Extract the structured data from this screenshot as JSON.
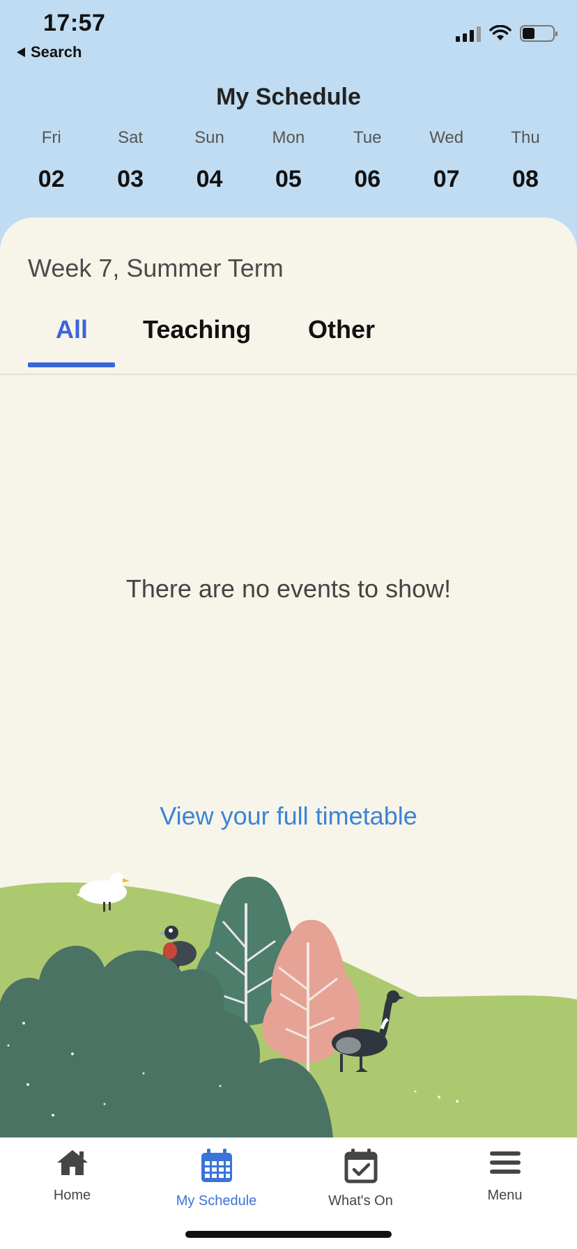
{
  "status_bar": {
    "time": "17:57",
    "back_label": "Search",
    "battery_level": 0.4
  },
  "header": {
    "title": "My Schedule"
  },
  "days": [
    {
      "name": "Fri",
      "num": "02"
    },
    {
      "name": "Sat",
      "num": "03"
    },
    {
      "name": "Sun",
      "num": "04"
    },
    {
      "name": "Mon",
      "num": "05"
    },
    {
      "name": "Tue",
      "num": "06"
    },
    {
      "name": "Wed",
      "num": "07"
    },
    {
      "name": "Thu",
      "num": "08"
    }
  ],
  "main": {
    "week_label": "Week 7, Summer Term",
    "tabs": [
      {
        "label": "All",
        "active": true
      },
      {
        "label": "Teaching",
        "active": false
      },
      {
        "label": "Other",
        "active": false
      }
    ],
    "empty_message": "There are no events to show!",
    "timetable_link": "View your full timetable"
  },
  "bottom_nav": [
    {
      "label": "Home",
      "icon": "home-icon",
      "active": false
    },
    {
      "label": "My Schedule",
      "icon": "calendar-icon",
      "active": true
    },
    {
      "label": "What's On",
      "icon": "calendar-check-icon",
      "active": false
    },
    {
      "label": "Menu",
      "icon": "menu-icon",
      "active": false
    }
  ],
  "colors": {
    "header_bg": "#bfdcf2",
    "panel_bg": "#f7f5ea",
    "accent": "#3a66d9",
    "link": "#3b84d6"
  }
}
